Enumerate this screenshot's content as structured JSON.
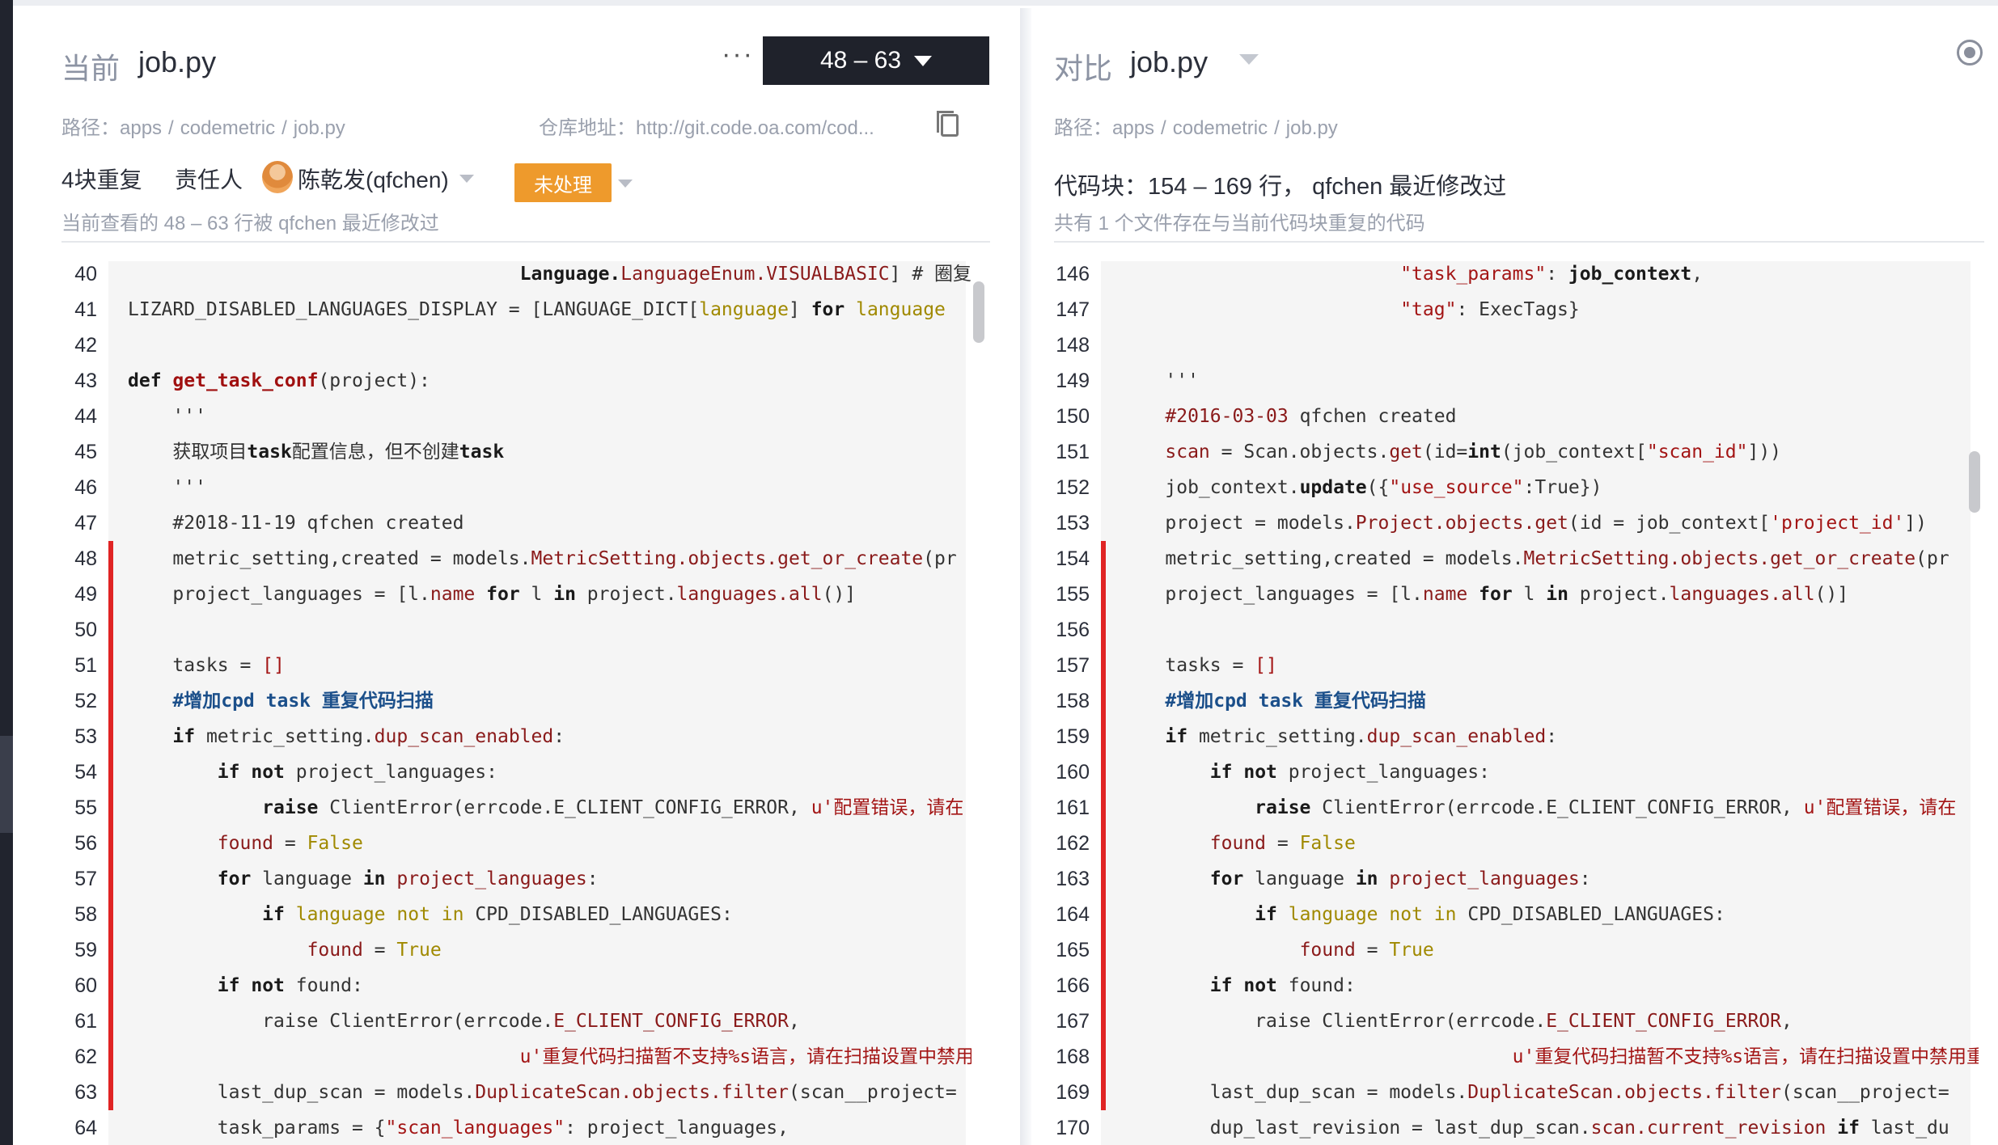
{
  "left_pane": {
    "title_prefix": "当前",
    "file_name": "job.py",
    "more": "···",
    "range": "48 – 63",
    "path_label": "路径：",
    "path_parts": [
      "apps",
      "codemetric",
      "job.py"
    ],
    "repo_text": "仓库地址：http://git.code.oa.com/cod...",
    "dup_count": "4块重复",
    "owner_label": "责任人",
    "owner_name": "陈乾发(qfchen)",
    "status": "未处理",
    "note": "当前查看的 48 – 63 行被 qfchen 最近修改过"
  },
  "right_pane": {
    "title_prefix": "对比",
    "file_name": "job.py",
    "path_label": "路径：",
    "path_parts": [
      "apps",
      "codemetric",
      "job.py"
    ],
    "block_info": "代码块：154 – 169 行， qfchen 最近修改过",
    "note": "共有 1 个文件存在与当前代码块重复的代码"
  },
  "left_code": {
    "line_numbers": [
      40,
      41,
      42,
      43,
      44,
      45,
      46,
      47,
      48,
      49,
      50,
      51,
      52,
      53,
      54,
      55,
      56,
      57,
      58,
      59,
      60,
      61,
      62,
      63,
      64
    ],
    "highlight_range": [
      48,
      63
    ],
    "lines": [
      [
        [
          "                                   ",
          ""
        ],
        [
          "Language.",
          "kw"
        ],
        [
          "LanguageEnum.VISUALBASIC",
          "at"
        ],
        [
          "] # 圈复杂度不",
          "cm"
        ]
      ],
      [
        [
          "LIZARD_DISABLED_LANGUAGES_DISPLAY = [LANGUAGE_DICT[",
          ""
        ],
        [
          "language",
          "bi"
        ],
        [
          "] ",
          ""
        ],
        [
          "for",
          "kw"
        ],
        [
          " ",
          ""
        ],
        [
          "language",
          "bi"
        ]
      ],
      [
        [
          "",
          ""
        ]
      ],
      [
        [
          "def",
          "kw"
        ],
        [
          " ",
          ""
        ],
        [
          "get_task_conf",
          "fn"
        ],
        [
          "(project):",
          ""
        ]
      ],
      [
        [
          "    '''",
          ""
        ]
      ],
      [
        [
          "    获取项目",
          ""
        ],
        [
          "task",
          "kw"
        ],
        [
          "配置信息，但不创建",
          ""
        ],
        [
          "task",
          "kw"
        ]
      ],
      [
        [
          "    '''",
          ""
        ]
      ],
      [
        [
          "    #2018-11-19 qfchen created",
          ""
        ]
      ],
      [
        [
          "    metric_setting,created = models.",
          ""
        ],
        [
          "MetricSetting.objects.get_or_create",
          "at"
        ],
        [
          "(pr",
          ""
        ]
      ],
      [
        [
          "    project_languages = [l.",
          ""
        ],
        [
          "name",
          "at"
        ],
        [
          " ",
          ""
        ],
        [
          "for",
          "kw"
        ],
        [
          " l ",
          ""
        ],
        [
          "in",
          "kw"
        ],
        [
          " project.",
          ""
        ],
        [
          "languages.all",
          "at"
        ],
        [
          "()]",
          ""
        ]
      ],
      [
        [
          "",
          ""
        ]
      ],
      [
        [
          "    tasks = ",
          ""
        ],
        [
          "[]",
          "st"
        ]
      ],
      [
        [
          "    #增加cpd task 重复代码扫描",
          "cmx"
        ]
      ],
      [
        [
          "    ",
          ""
        ],
        [
          "if",
          "kw"
        ],
        [
          " metric_setting.",
          ""
        ],
        [
          "dup_scan_enabled",
          "at"
        ],
        [
          ":",
          ""
        ]
      ],
      [
        [
          "        ",
          ""
        ],
        [
          "if",
          "kw"
        ],
        [
          " ",
          ""
        ],
        [
          "not",
          "kw"
        ],
        [
          " project_languages:",
          ""
        ]
      ],
      [
        [
          "            ",
          ""
        ],
        [
          "raise",
          "kw"
        ],
        [
          " ClientError(errcode.E_CLIENT_CONFIG_ERROR, ",
          ""
        ],
        [
          "u'配置错误，请在",
          "st"
        ]
      ],
      [
        [
          "        ",
          ""
        ],
        [
          "found",
          "at"
        ],
        [
          " = ",
          ""
        ],
        [
          "False",
          "bi"
        ]
      ],
      [
        [
          "        ",
          ""
        ],
        [
          "for",
          "kw"
        ],
        [
          " language ",
          ""
        ],
        [
          "in",
          "kw"
        ],
        [
          " ",
          ""
        ],
        [
          "project_languages",
          "at"
        ],
        [
          ":",
          ""
        ]
      ],
      [
        [
          "            ",
          ""
        ],
        [
          "if",
          "kw"
        ],
        [
          " ",
          ""
        ],
        [
          "language",
          "bi"
        ],
        [
          " ",
          ""
        ],
        [
          "not in",
          "bi"
        ],
        [
          " CPD_DISABLED_LANGUAGES:",
          ""
        ]
      ],
      [
        [
          "                ",
          ""
        ],
        [
          "found",
          "at"
        ],
        [
          " = ",
          ""
        ],
        [
          "True",
          "bi"
        ]
      ],
      [
        [
          "        ",
          ""
        ],
        [
          "if",
          "kw"
        ],
        [
          " ",
          ""
        ],
        [
          "not",
          "kw"
        ],
        [
          " found:",
          ""
        ]
      ],
      [
        [
          "            raise ClientError(errcode.",
          ""
        ],
        [
          "E_CLIENT_CONFIG_ERROR",
          "at"
        ],
        [
          ",",
          ""
        ]
      ],
      [
        [
          "                                   ",
          ""
        ],
        [
          "u'重复代码扫描暂不支持%s语言，请在扫描设置中禁用重复",
          "st"
        ]
      ],
      [
        [
          "        last_dup_scan = models.",
          ""
        ],
        [
          "DuplicateScan.objects.filter",
          "at"
        ],
        [
          "(scan__project=",
          ""
        ]
      ],
      [
        [
          "        task_params = {",
          ""
        ],
        [
          "\"scan_languages\"",
          "st"
        ],
        [
          ": project_languages,",
          ""
        ]
      ]
    ]
  },
  "right_code": {
    "line_numbers": [
      146,
      147,
      148,
      149,
      150,
      151,
      152,
      153,
      154,
      155,
      156,
      157,
      158,
      159,
      160,
      161,
      162,
      163,
      164,
      165,
      166,
      167,
      168,
      169,
      170
    ],
    "highlight_range": [
      154,
      169
    ],
    "lines": [
      [
        [
          "                         ",
          ""
        ],
        [
          "\"task_params\"",
          "st"
        ],
        [
          ": ",
          ""
        ],
        [
          "job_context",
          "kw"
        ],
        [
          ",",
          ""
        ]
      ],
      [
        [
          "                         ",
          ""
        ],
        [
          "\"tag\"",
          "st"
        ],
        [
          ": ExecTags}",
          ""
        ]
      ],
      [
        [
          "",
          ""
        ]
      ],
      [
        [
          "    '''",
          ""
        ]
      ],
      [
        [
          "    ",
          ""
        ],
        [
          "#2016-03-03",
          "at"
        ],
        [
          " qfchen created",
          ""
        ]
      ],
      [
        [
          "    ",
          ""
        ],
        [
          "scan",
          "at"
        ],
        [
          " = Scan.objects.",
          ""
        ],
        [
          "get",
          "at"
        ],
        [
          "(id=",
          ""
        ],
        [
          "int",
          "kw"
        ],
        [
          "(job_context[",
          ""
        ],
        [
          "\"scan_id\"",
          "st"
        ],
        [
          "]))",
          ""
        ]
      ],
      [
        [
          "    job_context.",
          ""
        ],
        [
          "update",
          "kw"
        ],
        [
          "({",
          ""
        ],
        [
          "\"use_source\"",
          "st"
        ],
        [
          ":True})",
          ""
        ]
      ],
      [
        [
          "    project = models.",
          ""
        ],
        [
          "Project.objects.get",
          "at"
        ],
        [
          "(id = job_context[",
          ""
        ],
        [
          "'project_id'",
          "st"
        ],
        [
          "])",
          ""
        ]
      ],
      [
        [
          "    metric_setting,created = models.",
          ""
        ],
        [
          "MetricSetting.objects.get_or_create",
          "at"
        ],
        [
          "(pr",
          ""
        ]
      ],
      [
        [
          "    project_languages = [l.",
          ""
        ],
        [
          "name",
          "at"
        ],
        [
          " ",
          ""
        ],
        [
          "for",
          "kw"
        ],
        [
          " l ",
          ""
        ],
        [
          "in",
          "kw"
        ],
        [
          " project.",
          ""
        ],
        [
          "languages.all",
          "at"
        ],
        [
          "()]",
          ""
        ]
      ],
      [
        [
          "",
          ""
        ]
      ],
      [
        [
          "    tasks = ",
          ""
        ],
        [
          "[]",
          "st"
        ]
      ],
      [
        [
          "    #增加cpd task 重复代码扫描",
          "cmx"
        ]
      ],
      [
        [
          "    ",
          ""
        ],
        [
          "if",
          "kw"
        ],
        [
          " metric_setting.",
          ""
        ],
        [
          "dup_scan_enabled",
          "at"
        ],
        [
          ":",
          ""
        ]
      ],
      [
        [
          "        ",
          ""
        ],
        [
          "if",
          "kw"
        ],
        [
          " ",
          ""
        ],
        [
          "not",
          "kw"
        ],
        [
          " project_languages:",
          ""
        ]
      ],
      [
        [
          "            ",
          ""
        ],
        [
          "raise",
          "kw"
        ],
        [
          " ClientError(errcode.E_CLIENT_CONFIG_ERROR, ",
          ""
        ],
        [
          "u'配置错误，请在",
          "st"
        ]
      ],
      [
        [
          "        ",
          ""
        ],
        [
          "found",
          "at"
        ],
        [
          " = ",
          ""
        ],
        [
          "False",
          "bi"
        ]
      ],
      [
        [
          "        ",
          ""
        ],
        [
          "for",
          "kw"
        ],
        [
          " language ",
          ""
        ],
        [
          "in",
          "kw"
        ],
        [
          " ",
          ""
        ],
        [
          "project_languages",
          "at"
        ],
        [
          ":",
          ""
        ]
      ],
      [
        [
          "            ",
          ""
        ],
        [
          "if",
          "kw"
        ],
        [
          " ",
          ""
        ],
        [
          "language",
          "bi"
        ],
        [
          " ",
          ""
        ],
        [
          "not in",
          "bi"
        ],
        [
          " CPD_DISABLED_LANGUAGES:",
          ""
        ]
      ],
      [
        [
          "                ",
          ""
        ],
        [
          "found",
          "at"
        ],
        [
          " = ",
          ""
        ],
        [
          "True",
          "bi"
        ]
      ],
      [
        [
          "        ",
          ""
        ],
        [
          "if",
          "kw"
        ],
        [
          " ",
          ""
        ],
        [
          "not",
          "kw"
        ],
        [
          " found:",
          ""
        ]
      ],
      [
        [
          "            raise ClientError(errcode.",
          ""
        ],
        [
          "E_CLIENT_CONFIG_ERROR",
          "at"
        ],
        [
          ",",
          ""
        ]
      ],
      [
        [
          "                                   ",
          ""
        ],
        [
          "u'重复代码扫描暂不支持%s语言，请在扫描设置中禁用重复",
          "st"
        ]
      ],
      [
        [
          "        last_dup_scan = models.",
          ""
        ],
        [
          "DuplicateScan.objects.filter",
          "at"
        ],
        [
          "(scan__project=",
          ""
        ]
      ],
      [
        [
          "        dup_last_revision = last_dup_scan.",
          ""
        ],
        [
          "scan.current_revision",
          "at"
        ],
        [
          " ",
          ""
        ],
        [
          "if",
          "kw"
        ],
        [
          " last_du",
          ""
        ]
      ]
    ]
  },
  "colors": {
    "accent_dark": "#1f222b",
    "status_orange": "#ee9a2c",
    "highlight_red": "#e02424",
    "code_bg": "#f5f5f5"
  }
}
